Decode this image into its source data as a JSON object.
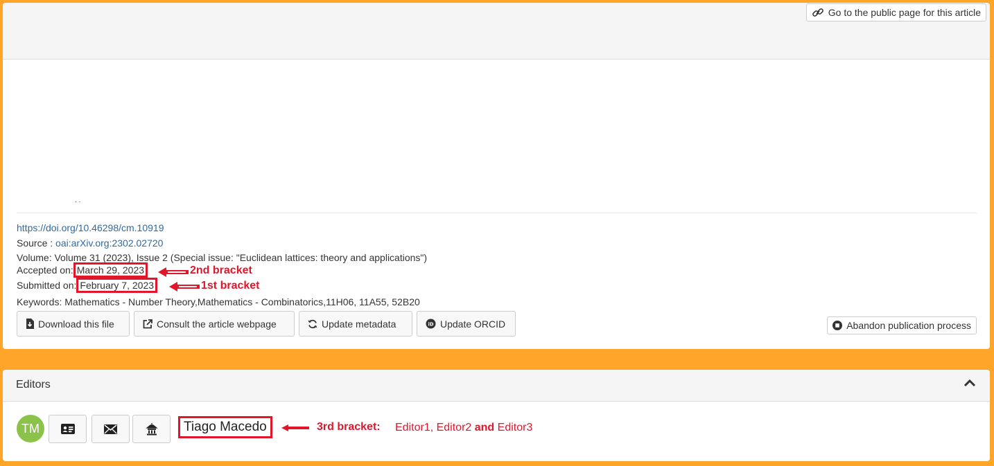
{
  "public_page_button": "Go to the public page for this article",
  "article": {
    "crop_text": ". .",
    "doi_link": "https://doi.org/10.46298/cm.10919",
    "source_label": "Source :",
    "source_link": "oai:arXiv.org:2302.02720",
    "volume": "Volume: Volume 31 (2023), Issue 2 (Special issue: \"Euclidean lattices: theory and applications\")",
    "accepted_label": "Accepted on:",
    "accepted_date": "March 29, 2023",
    "submitted_label": "Submitted on:",
    "submitted_date": "February 7, 2023",
    "keywords": "Keywords: Mathematics - Number Theory,Mathematics - Combinatorics,11H06, 11A55, 52B20"
  },
  "actions": {
    "download": "Download this file",
    "consult": "Consult the article webpage",
    "update_metadata": "Update metadata",
    "update_orcid": "Update ORCID",
    "abandon": "Abandon publication process"
  },
  "annotations": {
    "bracket2": "2nd bracket",
    "bracket1": "1st bracket",
    "bracket3_bold": "3rd bracket",
    "bracket3_colon": ":",
    "editor1": "Editor1,",
    "editor2": "Editor2",
    "and_word": "and",
    "editor3": "Editor3"
  },
  "editors": {
    "title": "Editors",
    "avatar_initials": "TM",
    "name": "Tiago Macedo"
  },
  "colors": {
    "background_orange": "#ffa52a",
    "annotation_red": "#e0162b",
    "avatar_green": "#8bc34a",
    "link_blue": "#2d6aa3"
  },
  "icons": [
    "link-icon",
    "file-download-icon",
    "external-link-icon",
    "refresh-icon",
    "orcid-icon",
    "stop-icon",
    "chevron-up-icon",
    "id-card-icon",
    "envelope-icon",
    "institution-icon",
    "arrow-left-icon"
  ]
}
